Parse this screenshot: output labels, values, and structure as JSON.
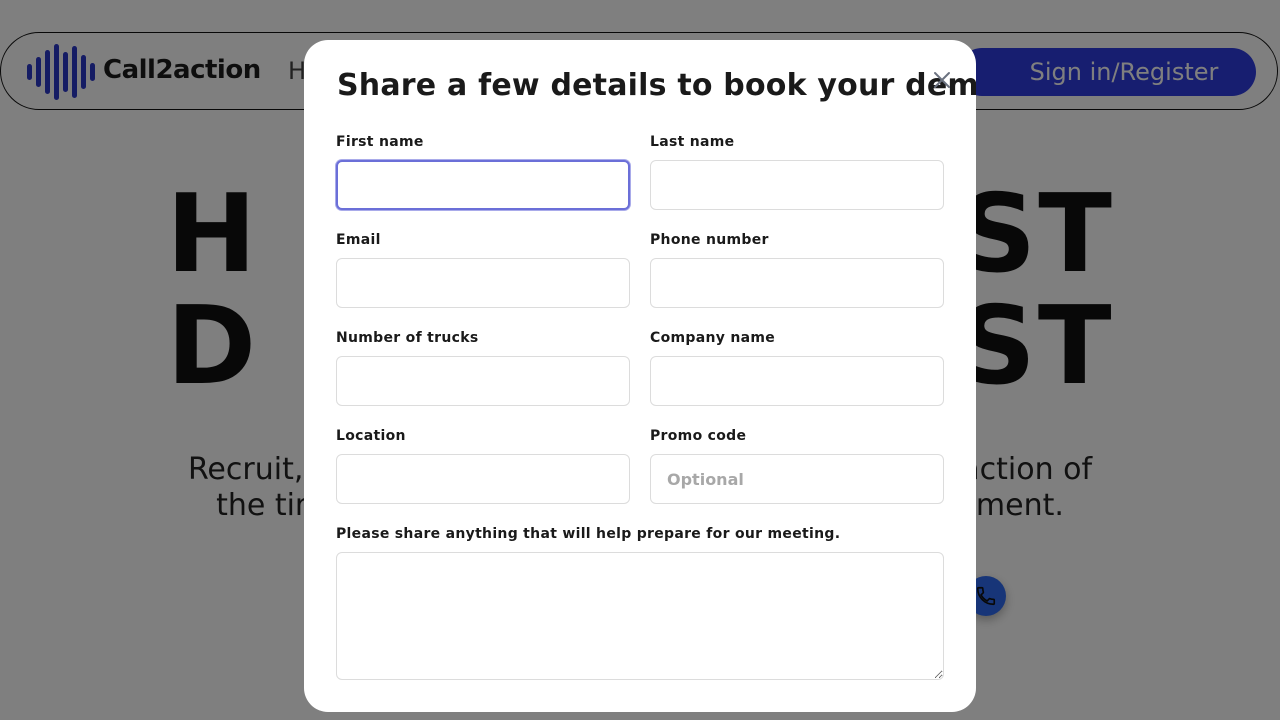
{
  "nav": {
    "brand": "Call2action",
    "partial_link": "H",
    "signin_label": "Sign in/Register"
  },
  "hero": {
    "line1_left": "H",
    "line1_right": "ST",
    "line2_left": "D",
    "line2_right": "ST",
    "sub1_left": "Recruit, i",
    "sub1_right": "action of",
    "sub2_left": "the tim",
    "sub2_right": "tment."
  },
  "modal": {
    "title": "Share a few details to book your demo",
    "close_icon": "close-icon",
    "fields": {
      "first_name": {
        "label": "First name",
        "value": "",
        "placeholder": ""
      },
      "last_name": {
        "label": "Last name",
        "value": "",
        "placeholder": ""
      },
      "email": {
        "label": "Email",
        "value": "",
        "placeholder": ""
      },
      "phone": {
        "label": "Phone number",
        "value": "",
        "placeholder": ""
      },
      "trucks": {
        "label": "Number of trucks",
        "value": "",
        "placeholder": ""
      },
      "company": {
        "label": "Company name",
        "value": "",
        "placeholder": ""
      },
      "location": {
        "label": "Location",
        "value": "",
        "placeholder": ""
      },
      "promo": {
        "label": "Promo code",
        "value": "",
        "placeholder": "Optional"
      }
    },
    "notes": {
      "label": "Please share anything that will help prepare for our meeting.",
      "value": ""
    }
  },
  "colors": {
    "brand_blue": "#2f3ce0",
    "focus_ring": "#6b6fd8",
    "overlay": "rgba(0,0,0,0.5)"
  }
}
